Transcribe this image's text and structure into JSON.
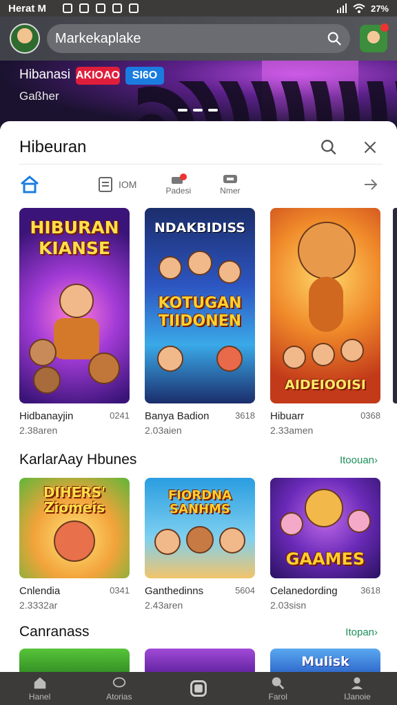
{
  "status_bar": {
    "time": "Herat M",
    "battery": "27%"
  },
  "header": {
    "search_placeholder": "Markekaplake"
  },
  "hero": {
    "title": "Hibanasi",
    "badge_red": "AKIOAO",
    "badge_blue": "SI6O",
    "subtitle": "Gaßher"
  },
  "sheet": {
    "title": "Hibeuran",
    "tabs": [
      {
        "label": ""
      },
      {
        "label": "IOM"
      },
      {
        "label": "Padesi"
      },
      {
        "label": "Nmer"
      }
    ]
  },
  "row1": [
    {
      "art": "HIBURAN KIANSE",
      "name": "Hidbanayjin",
      "num": "0241",
      "sub": "2.38aren"
    },
    {
      "art_top": "NDAKBIDISS",
      "art": "KOTUGAN TIIDONEN",
      "name": "Banya Badion",
      "num": "3618",
      "sub": "2.03aien"
    },
    {
      "art": "AIDEIOOISI",
      "name": "Hibuarr",
      "num": "0368",
      "sub": "2.33amen"
    }
  ],
  "section2": {
    "title": "KarlarAay Hbunes",
    "link": "Itoouan›"
  },
  "row2": [
    {
      "art": "DIHERS' Ziomeis",
      "name": "Cnlendia",
      "num": "0341",
      "sub": "2.3332ar"
    },
    {
      "art": "FIORDNA SANHMS",
      "name": "Ganthedinns",
      "num": "5604",
      "sub": "2.43aren"
    },
    {
      "art": "GAAMES",
      "name": "Celanedording",
      "num": "3618",
      "sub": "2.03sisn"
    }
  ],
  "section3": {
    "title": "Canranass",
    "link": "Itopan›"
  },
  "row3": [
    {
      "art": ""
    },
    {
      "art": ""
    },
    {
      "art": "Mulisk"
    }
  ],
  "bottom_nav": [
    {
      "label": "Hanel"
    },
    {
      "label": "Atorias"
    },
    {
      "label": ""
    },
    {
      "label": "Farol"
    },
    {
      "label": "IJanoie"
    }
  ],
  "colors": {
    "accent_link": "#1c8f5a",
    "badge_red": "#e01e3b",
    "badge_blue": "#1b7ce0",
    "nav_bg": "#3d3b3a"
  }
}
